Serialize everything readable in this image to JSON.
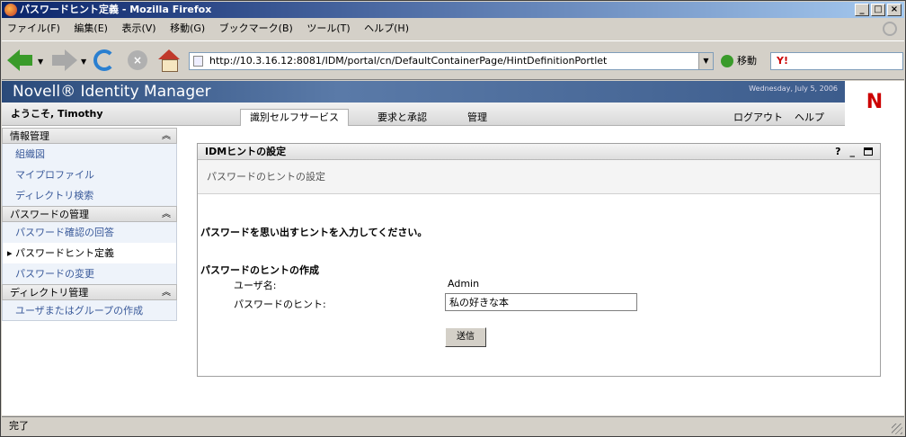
{
  "window": {
    "title": "パスワードヒント定義 - Mozilla Firefox",
    "controls": [
      "_",
      "□",
      "×"
    ]
  },
  "menu": [
    "ファイル(F)",
    "編集(E)",
    "表示(V)",
    "移動(G)",
    "ブックマーク(B)",
    "ツール(T)",
    "ヘルプ(H)"
  ],
  "toolbar": {
    "url": "http://10.3.16.12:8081/IDM/portal/cn/DefaultContainerPage/HintDefinitionPortlet",
    "go_label": "移動",
    "search_logo": "Y!"
  },
  "app": {
    "brand": "Novell® Identity Manager",
    "date": "Wednesday, July 5, 2006",
    "logo": "N",
    "welcome": "ようこそ, Timothy"
  },
  "tabs": [
    "識別セルフサービス",
    "要求と承認",
    "管理"
  ],
  "top_links": {
    "logout": "ログアウト",
    "help": "ヘルプ"
  },
  "sidebar": {
    "sections": [
      {
        "title": "情報管理",
        "items": [
          "組織図",
          "マイプロファイル",
          "ディレクトリ検索"
        ]
      },
      {
        "title": "パスワードの管理",
        "items": [
          "パスワード確認の回答",
          "パスワードヒント定義",
          "パスワードの変更"
        ]
      },
      {
        "title": "ディレクトリ管理",
        "items": [
          "ユーザまたはグループの作成"
        ]
      }
    ]
  },
  "portlet": {
    "title": "IDMヒントの設定",
    "controls": {
      "help": "?",
      "minimize": "_"
    },
    "subtitle": "パスワードのヒントの設定",
    "instruction": "パスワードを思い出すヒントを入力してください。",
    "section": "パスワードのヒントの作成",
    "username_label": "ユーザ名:",
    "username_value": "Admin",
    "hint_label": "パスワードのヒント:",
    "hint_value": "私の好きな本",
    "submit": "送信"
  },
  "status": "完了"
}
